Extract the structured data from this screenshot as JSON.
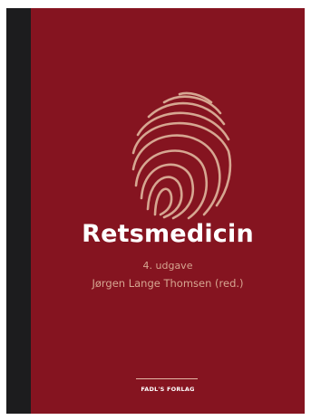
{
  "book": {
    "title": "Retsmedicin",
    "edition": "4. udgave",
    "author": "Jørgen Lange Thomsen (red.)",
    "publisher": "FADL'S FORLAG"
  },
  "colors": {
    "cover_background": "#851420",
    "spine": "#1c1c1e",
    "accent": "#d6a691",
    "title_text": "#ffffff"
  },
  "icons": {
    "cover_illustration": "fingerprint-icon"
  }
}
